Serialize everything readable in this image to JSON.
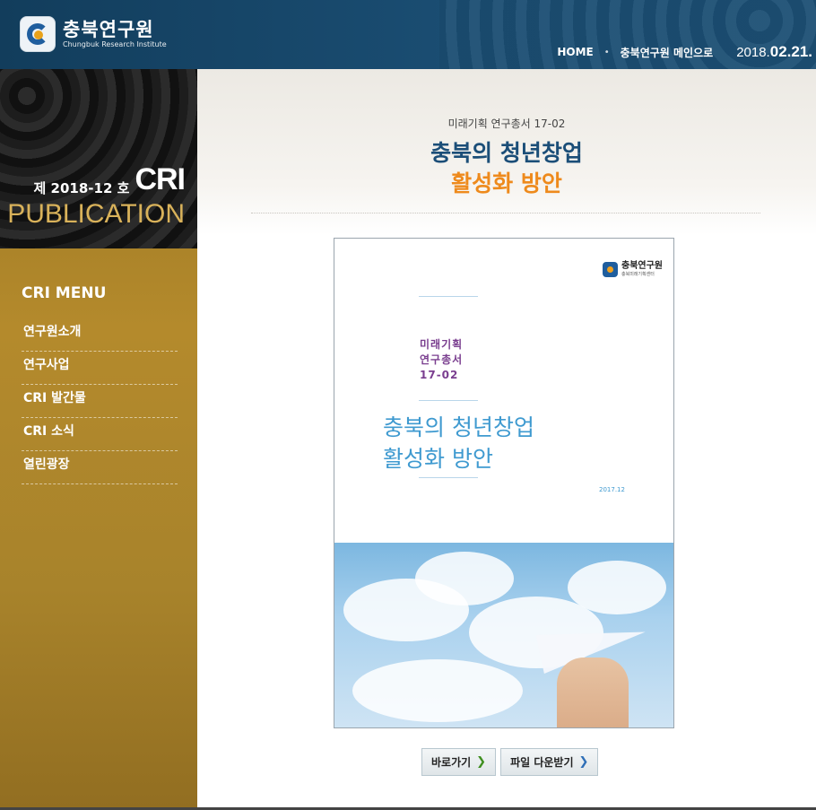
{
  "header": {
    "logo_name": "충북연구원",
    "logo_sub": "Chungbuk Research Institute",
    "nav": [
      {
        "label": "HOME"
      },
      {
        "label": "충북연구원 메인으로"
      }
    ],
    "date_prefix": "2018.",
    "date_main": "02.21."
  },
  "sidebar": {
    "issue": "제 2018-12 호",
    "brand": "CRI",
    "publication": "PUBLICATION",
    "menu_title": "CRI MENU",
    "items": [
      {
        "label": "연구원소개"
      },
      {
        "label": "연구사업"
      },
      {
        "label": "CRI 발간물"
      },
      {
        "label": "CRI 소식"
      },
      {
        "label": "열린광장"
      }
    ]
  },
  "main": {
    "series": "미래기획 연구총서 17-02",
    "title_line1": "충북의 청년창업",
    "title_line2": "활성화 방안",
    "cover": {
      "logo_name": "충북연구원",
      "logo_sub": "충북미래기획센터",
      "series_lines": [
        "미래기획",
        "연구총서",
        "17-02"
      ],
      "title_lines": [
        "충북의 청년창업",
        "활성화 방안"
      ],
      "date": "2017.12"
    },
    "buttons": {
      "goto": "바로가기",
      "download": "파일 다운받기"
    }
  },
  "colors": {
    "header_bg": "#1a4d72",
    "sidebar_gold": "#b48a2c",
    "title_blue": "#1b4e78",
    "title_orange": "#ee8a1c",
    "cover_blue": "#3f9ad0"
  }
}
